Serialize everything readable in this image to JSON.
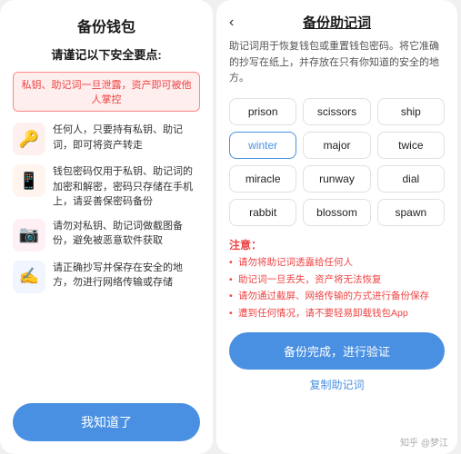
{
  "left": {
    "title": "备份钱包",
    "heading": "请谨记以下安全要点:",
    "warning": "私钥、助记词一旦泄露，资产即可被他人掌控",
    "items": [
      {
        "icon": "🔑",
        "iconClass": "icon-red",
        "text": "任何人，只要持有私钥、助记词，即可将资产转走"
      },
      {
        "icon": "📱",
        "iconClass": "icon-orange",
        "text": "钱包密码仅用于私钥、助记词的加密和解密，密码只存储在手机上，请妥善保密码备份"
      },
      {
        "icon": "📷",
        "iconClass": "icon-pink",
        "text": "请勿对私钥、助记词做截图备份，避免被恶意软件获取"
      },
      {
        "icon": "✍️",
        "iconClass": "icon-blue",
        "text": "请正确抄写并保存在安全的地方，勿进行网络传输或存储"
      }
    ],
    "button": "我知道了"
  },
  "right": {
    "title": "备份助记词",
    "description": "助记词用于恢复钱包或重置钱包密码。将它准确的抄写在纸上，并存放在只有你知道的安全的地方。",
    "words": [
      "prison",
      "scissors",
      "ship",
      "winter",
      "major",
      "twice",
      "miracle",
      "runway",
      "dial",
      "rabbit",
      "blossom",
      "spawn"
    ],
    "highlight_word": "winter",
    "notes_title": "注意：",
    "notes": [
      "请勿将助记词透露给任何人",
      "助记词一旦丢失，资产将无法恢复",
      "请勿通过截屏、网络传输的方式进行备份保存",
      "遭到任何情况，请不要轻易卸载钱包App"
    ],
    "action_button": "备份完成，进行验证",
    "copy_link": "复制助记词"
  },
  "watermark": "知乎 @梦江"
}
